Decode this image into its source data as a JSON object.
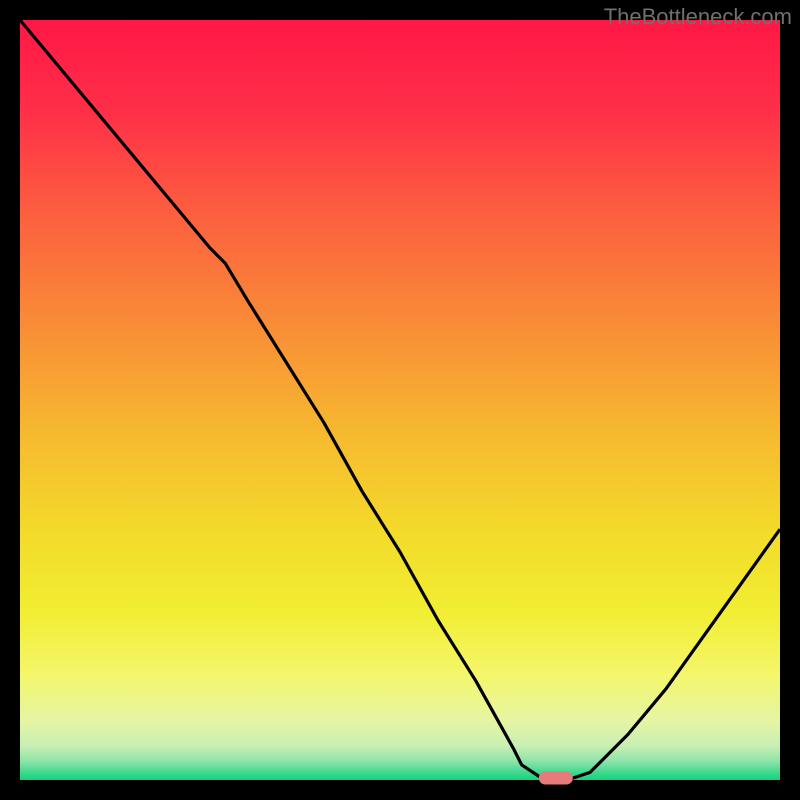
{
  "watermark_text": "TheBottleneck.com",
  "chart_data": {
    "type": "line",
    "title": "",
    "xlabel": "",
    "ylabel": "",
    "x_min": 0,
    "x_max": 100,
    "y_min": 0,
    "y_max": 100,
    "series": [
      {
        "name": "bottleneck-curve",
        "x": [
          0,
          5,
          10,
          15,
          20,
          25,
          27,
          30,
          35,
          40,
          45,
          50,
          55,
          60,
          65,
          66,
          69,
          72,
          75,
          80,
          85,
          90,
          95,
          100
        ],
        "values": [
          100,
          94,
          88,
          82,
          76,
          70,
          68,
          63,
          55,
          47,
          38,
          30,
          21,
          13,
          4,
          2,
          0,
          0,
          1,
          6,
          12,
          19,
          26,
          33
        ]
      }
    ],
    "marker": {
      "x": 70.5,
      "y": 0,
      "color": "#e77a7a",
      "label": "optimal-point"
    },
    "background_gradient": {
      "stops": [
        {
          "offset": 0.0,
          "color": "#ff1846"
        },
        {
          "offset": 0.12,
          "color": "#ff2f48"
        },
        {
          "offset": 0.25,
          "color": "#fc5d3f"
        },
        {
          "offset": 0.4,
          "color": "#f98c37"
        },
        {
          "offset": 0.55,
          "color": "#f6bb2f"
        },
        {
          "offset": 0.68,
          "color": "#f3dc2a"
        },
        {
          "offset": 0.78,
          "color": "#f1ee33"
        },
        {
          "offset": 0.86,
          "color": "#f4f66a"
        },
        {
          "offset": 0.92,
          "color": "#e7f5a2"
        },
        {
          "offset": 0.955,
          "color": "#c8efb4"
        },
        {
          "offset": 0.975,
          "color": "#8fe4a9"
        },
        {
          "offset": 0.99,
          "color": "#3ed98d"
        },
        {
          "offset": 1.0,
          "color": "#12d381"
        }
      ]
    },
    "border_color": "#000000",
    "border_width": 20,
    "line_color": "#000000",
    "line_width": 3.2
  }
}
